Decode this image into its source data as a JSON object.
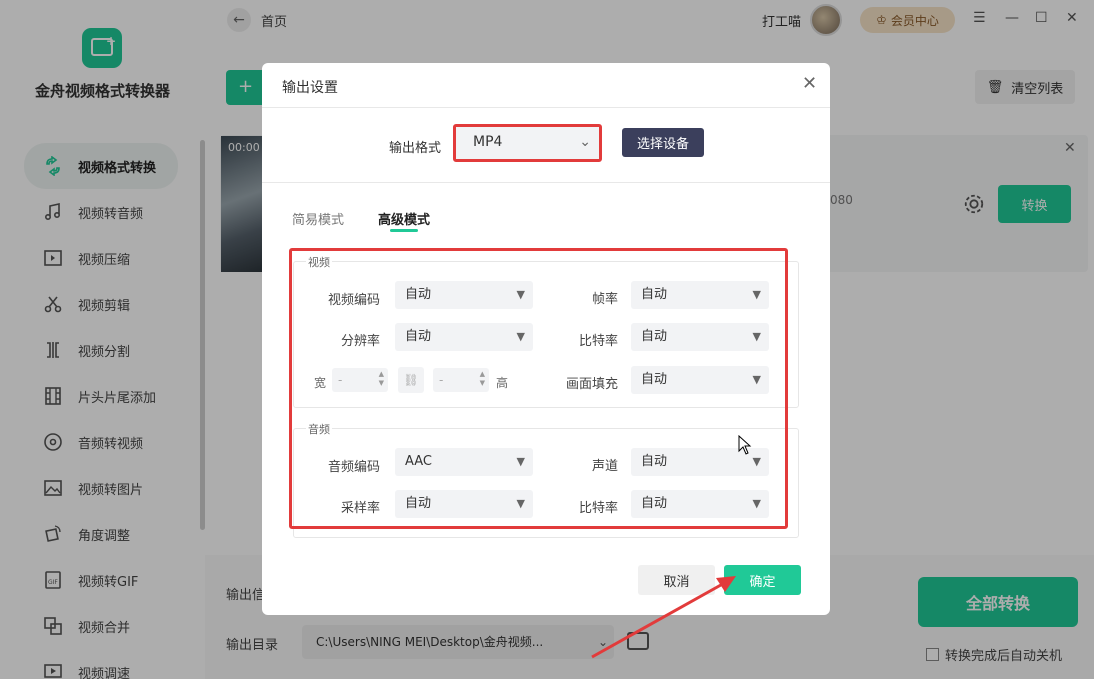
{
  "app": {
    "title": "金舟视频格式转换器",
    "breadcrumb": "首页",
    "user_name": "打工喵",
    "vip_label": "会员中心",
    "brand_color": "#20c997"
  },
  "sidebar": {
    "items": [
      {
        "label": "视频格式转换",
        "icon": "convert-icon",
        "active": true
      },
      {
        "label": "视频转音频",
        "icon": "music-note-icon"
      },
      {
        "label": "视频压缩",
        "icon": "compress-icon"
      },
      {
        "label": "视频剪辑",
        "icon": "scissors-icon"
      },
      {
        "label": "视频分割",
        "icon": "split-icon"
      },
      {
        "label": "片头片尾添加",
        "icon": "film-strip-icon"
      },
      {
        "label": "音频转视频",
        "icon": "audio-disc-icon"
      },
      {
        "label": "视频转图片",
        "icon": "image-icon"
      },
      {
        "label": "角度调整",
        "icon": "rotate-icon"
      },
      {
        "label": "视频转GIF",
        "icon": "gif-icon"
      },
      {
        "label": "视频合并",
        "icon": "merge-icon"
      },
      {
        "label": "视频调速",
        "icon": "speed-icon"
      }
    ]
  },
  "toolbar": {
    "add_label": "+",
    "clear_label": "清空列表"
  },
  "file_item": {
    "thumb_time": "00:00",
    "resolution_fragment": "080",
    "convert_label": "转换"
  },
  "bottom": {
    "output_label_fragment": "输出信",
    "output_dir_label": "输出目录",
    "output_path": "C:\\Users\\NING MEI\\Desktop\\金舟视频...",
    "convert_all_label": "全部转换",
    "shutdown_label": "转换完成后自动关机"
  },
  "modal": {
    "title": "输出设置",
    "format_label": "输出格式",
    "format_value": "MP4",
    "device_button": "选择设备",
    "tabs": [
      "简易模式",
      "高级模式"
    ],
    "active_tab": "高级模式",
    "video": {
      "section_title": "视频",
      "codec_label": "视频编码",
      "codec_value": "自动",
      "fps_label": "帧率",
      "fps_value": "自动",
      "resolution_label": "分辨率",
      "resolution_value": "自动",
      "bitrate_label": "比特率",
      "bitrate_value": "自动",
      "width_label": "宽",
      "width_value": "-",
      "height_label": "高",
      "height_value": "-",
      "fill_label": "画面填充",
      "fill_value": "自动"
    },
    "audio": {
      "section_title": "音频",
      "codec_label": "音频编码",
      "codec_value": "AAC",
      "channel_label": "声道",
      "channel_value": "自动",
      "samplerate_label": "采样率",
      "samplerate_value": "自动",
      "bitrate_label": "比特率",
      "bitrate_value": "自动"
    },
    "cancel_label": "取消",
    "ok_label": "确定"
  },
  "annotation_color": "#e23b3b"
}
